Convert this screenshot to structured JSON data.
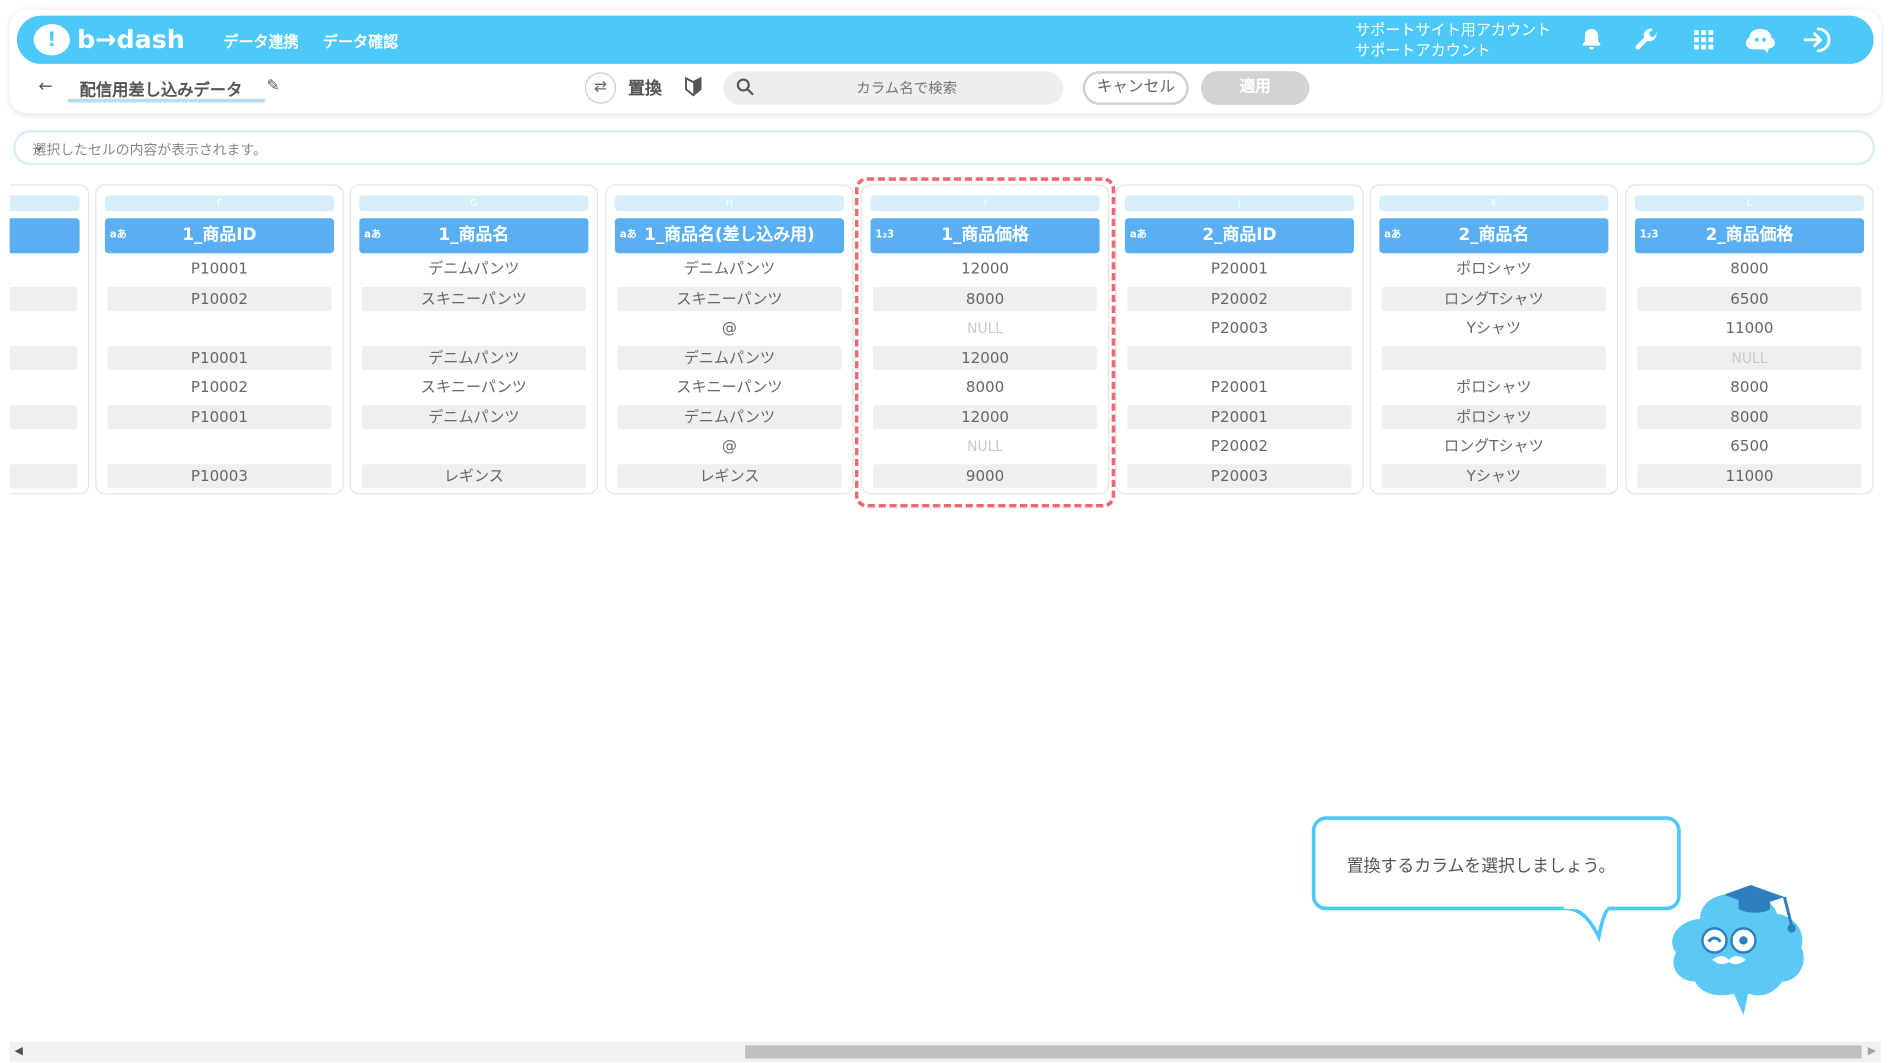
{
  "header": {
    "logo_text": "b→dash",
    "nav": [
      "データ連携",
      "データ確認"
    ],
    "account_line1": "サポートサイト用アカウント",
    "account_line2": "サポートアカウント"
  },
  "toolbar": {
    "datasource_name": "配信用差し込みデータ",
    "replace_label": "置換",
    "search_placeholder": "カラム名で検索",
    "cancel_label": "キャンセル",
    "apply_label": "適用"
  },
  "cell_bar": {
    "placeholder": "選択したセルの内容が表示されます。"
  },
  "columns": [
    {
      "letter": "F",
      "type": "aあ",
      "name": "1_商品ID",
      "cells": [
        "P10001",
        "P10002",
        "",
        "P10001",
        "P10002",
        "P10001",
        "",
        "P10003"
      ]
    },
    {
      "letter": "G",
      "type": "aあ",
      "name": "1_商品名",
      "cells": [
        "デニムパンツ",
        "スキニーパンツ",
        "",
        "デニムパンツ",
        "スキニーパンツ",
        "デニムパンツ",
        "",
        "レギンス"
      ]
    },
    {
      "letter": "H",
      "type": "aあ",
      "name": "1_商品名(差し込み用)",
      "cells": [
        "デニムパンツ",
        "スキニーパンツ",
        "@",
        "デニムパンツ",
        "スキニーパンツ",
        "デニムパンツ",
        "@",
        "レギンス"
      ]
    },
    {
      "letter": "I",
      "type": "1₂3",
      "name": "1_商品価格",
      "cells": [
        "12000",
        "8000",
        "NULL",
        "12000",
        "8000",
        "12000",
        "NULL",
        "9000"
      ]
    },
    {
      "letter": "J",
      "type": "aあ",
      "name": "2_商品ID",
      "cells": [
        "P20001",
        "P20002",
        "P20003",
        "",
        "P20001",
        "P20001",
        "P20002",
        "P20003"
      ]
    },
    {
      "letter": "K",
      "type": "aあ",
      "name": "2_商品名",
      "cells": [
        "ポロシャツ",
        "ロングTシャツ",
        "Yシャツ",
        "",
        "ポロシャツ",
        "ポロシャツ",
        "ロングTシャツ",
        "Yシャツ"
      ]
    },
    {
      "letter": "L",
      "type": "1₂3",
      "name": "2_商品価格",
      "cells": [
        "8000",
        "6500",
        "11000",
        "NULL",
        "8000",
        "8000",
        "6500",
        "11000"
      ]
    }
  ],
  "tooltip": {
    "text": "置換するカラムを選択しましょう。"
  },
  "colors": {
    "brand": "#4dc8fb",
    "column_header": "#5aaef2",
    "highlight": "#f06873"
  }
}
